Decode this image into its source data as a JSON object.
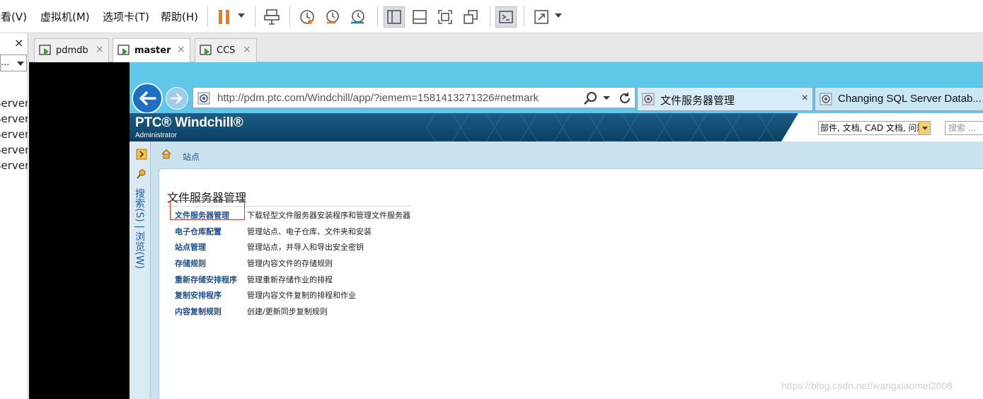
{
  "menubar": {
    "items": [
      {
        "label": "查看(V)"
      },
      {
        "label": "虚拟机(M)"
      },
      {
        "label": "选项卡(T)"
      },
      {
        "label": "帮助(H)"
      }
    ],
    "colors": {
      "pause": "#f07a1c"
    }
  },
  "library": {
    "close_glyph": "×",
    "select_value": "...",
    "items": [
      "Server",
      "Server",
      "Server",
      "Server",
      "Server"
    ]
  },
  "vm_tabs": [
    {
      "label": "pdmdb",
      "close": "×"
    },
    {
      "label": "master",
      "close": "×"
    },
    {
      "label": "CCS",
      "close": "×"
    }
  ],
  "browser": {
    "url": "http://pdm.ptc.com/Windchill/app/?iemem=1581413271326#netmark",
    "tabs": [
      {
        "label": "文件服务器管理",
        "close": "×"
      },
      {
        "label": "Changing SQL Server Datab..."
      }
    ]
  },
  "windchill": {
    "logo": "PTC® Windchill®",
    "user": "Administrator",
    "search_type": "部件, 文档, CAD 文档, 问题报告",
    "search_placeholder": "搜索 ...",
    "nav_vertical": "搜索(S) | 浏览(W)",
    "breadcrumb": "站点",
    "page_title": "文件服务器管理",
    "rows": [
      {
        "link": "文件服务器管理",
        "desc": "下载轻型文件服务器安装程序和管理文件服务器"
      },
      {
        "link": "电子仓库配置",
        "desc": "管理站点、电子仓库、文件夹和安装"
      },
      {
        "link": "站点管理",
        "desc": "管理站点，并导入和导出安全密钥"
      },
      {
        "link": "存储规则",
        "desc": "管理内容文件的存储规则"
      },
      {
        "link": "重新存储安排程序",
        "desc": "管理重新存储作业的排程"
      },
      {
        "link": "复制安排程序",
        "desc": "管理内容文件复制的排程和作业"
      },
      {
        "link": "内容复制规则",
        "desc": "创建/更新同步复制规则"
      }
    ],
    "colors": {
      "header": "#0f4a70",
      "link": "#1f4e8b",
      "highlight": "#e0342c"
    }
  },
  "watermark": "https://blog.csdn.net/wangxiaomei2008"
}
